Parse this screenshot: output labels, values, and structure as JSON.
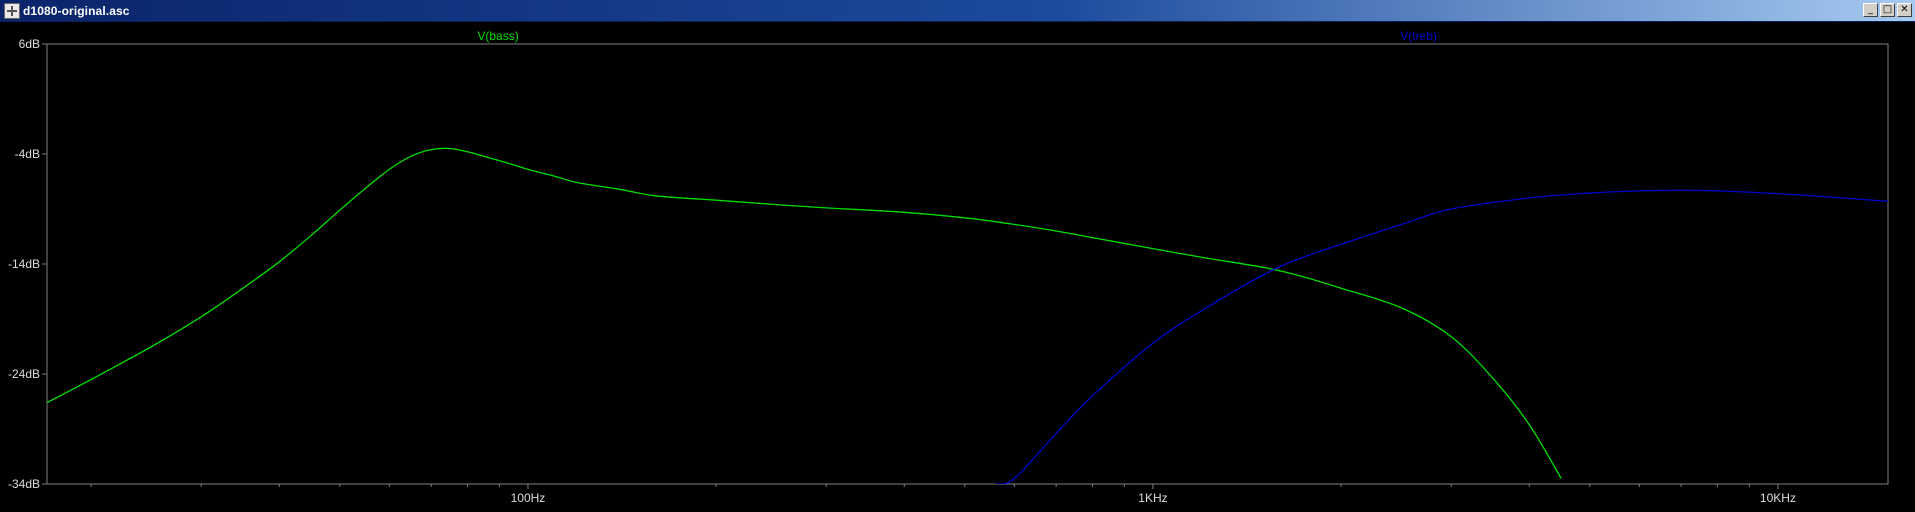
{
  "window": {
    "title": "d1080-original.asc",
    "minimize_label": "_",
    "maximize_label": "□",
    "close_label": "✕"
  },
  "chart_data": {
    "type": "line",
    "xscale": "log",
    "xlim": [
      17,
      15000
    ],
    "ylim": [
      -34,
      6
    ],
    "xunit": "Hz",
    "yunit": "dB",
    "grid": false,
    "legend": "top",
    "x_ticks": [
      {
        "value": 100,
        "label": "100Hz"
      },
      {
        "value": 1000,
        "label": "1KHz"
      },
      {
        "value": 10000,
        "label": "10KHz"
      }
    ],
    "y_ticks": [
      {
        "value": 6,
        "label": "6dB"
      },
      {
        "value": -4,
        "label": "-4dB"
      },
      {
        "value": -14,
        "label": "-14dB"
      },
      {
        "value": -24,
        "label": "-24dB"
      },
      {
        "value": -34,
        "label": "-34dB"
      }
    ],
    "series": [
      {
        "name": "V(bass)",
        "color": "#00dd00",
        "x": [
          17,
          20,
          25,
          30,
          35,
          40,
          45,
          50,
          55,
          60,
          65,
          70,
          75,
          80,
          85,
          90,
          95,
          100,
          110,
          120,
          140,
          160,
          200,
          250,
          300,
          400,
          500,
          600,
          700,
          800,
          1000,
          1200,
          1500,
          1700,
          2000,
          2500,
          3000,
          3500,
          4000,
          4500
        ],
        "y": [
          -26.6,
          -24.5,
          -21.5,
          -18.8,
          -16.2,
          -13.8,
          -11.4,
          -9.1,
          -7.1,
          -5.4,
          -4.2,
          -3.6,
          -3.5,
          -3.8,
          -4.2,
          -4.6,
          -5.0,
          -5.4,
          -6.0,
          -6.6,
          -7.2,
          -7.8,
          -8.2,
          -8.6,
          -8.9,
          -9.3,
          -9.8,
          -10.4,
          -11.0,
          -11.6,
          -12.6,
          -13.4,
          -14.3,
          -15.0,
          -16.2,
          -18.0,
          -20.6,
          -24.4,
          -28.6,
          -33.5
        ]
      },
      {
        "name": "V(treb)",
        "color": "#0000cc",
        "x": [
          560,
          600,
          700,
          800,
          1000,
          1200,
          1500,
          1700,
          2000,
          2500,
          3000,
          4000,
          5000,
          6000,
          7000,
          8000,
          10000,
          12000,
          15000
        ],
        "y": [
          -34,
          -33.5,
          -29.4,
          -26.0,
          -21.2,
          -18.2,
          -15.0,
          -13.6,
          -12.2,
          -10.4,
          -9.0,
          -8.0,
          -7.55,
          -7.35,
          -7.3,
          -7.35,
          -7.6,
          -7.9,
          -8.3
        ]
      }
    ]
  }
}
